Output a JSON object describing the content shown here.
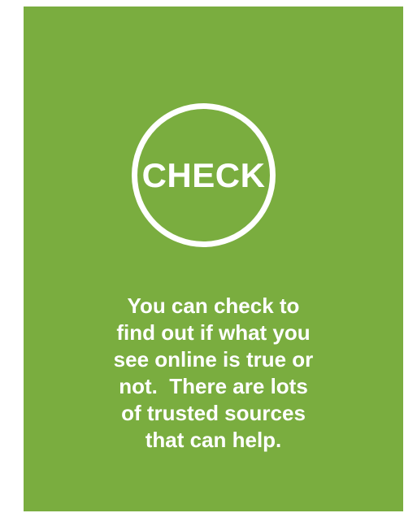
{
  "card": {
    "circle_label": "CHECK",
    "description_lines": [
      "You can check to",
      "find out if what you",
      "see online is true or",
      "not.  There are lots",
      "of trusted sources",
      "that can help."
    ]
  },
  "colors": {
    "card_background": "#7aad3f",
    "text": "#ffffff",
    "page_background": "#ffffff"
  }
}
